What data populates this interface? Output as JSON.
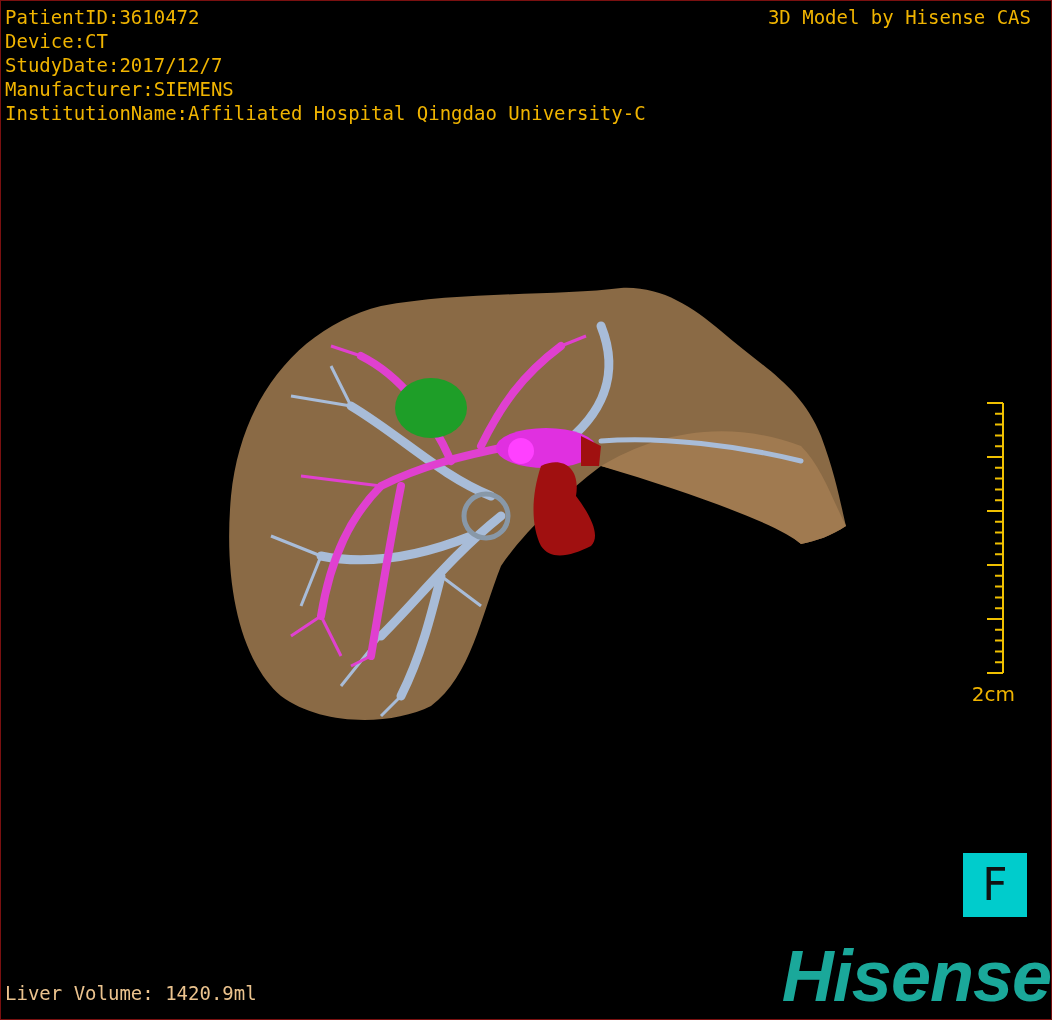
{
  "info_lines": [
    "PatientID:3610472",
    "Device:CT",
    "StudyDate:2017/12/7",
    "Manufacturer:SIEMENS",
    "InstitutionName:Affiliated Hospital Qingdao University-C"
  ],
  "credit": "3D Model by Hisense CAS",
  "scale_bar": {
    "label": "2cm"
  },
  "orientation_cube": {
    "label": "F"
  },
  "liver_volume": "Liver Volume: 1420.9ml",
  "logo": "Hisense"
}
